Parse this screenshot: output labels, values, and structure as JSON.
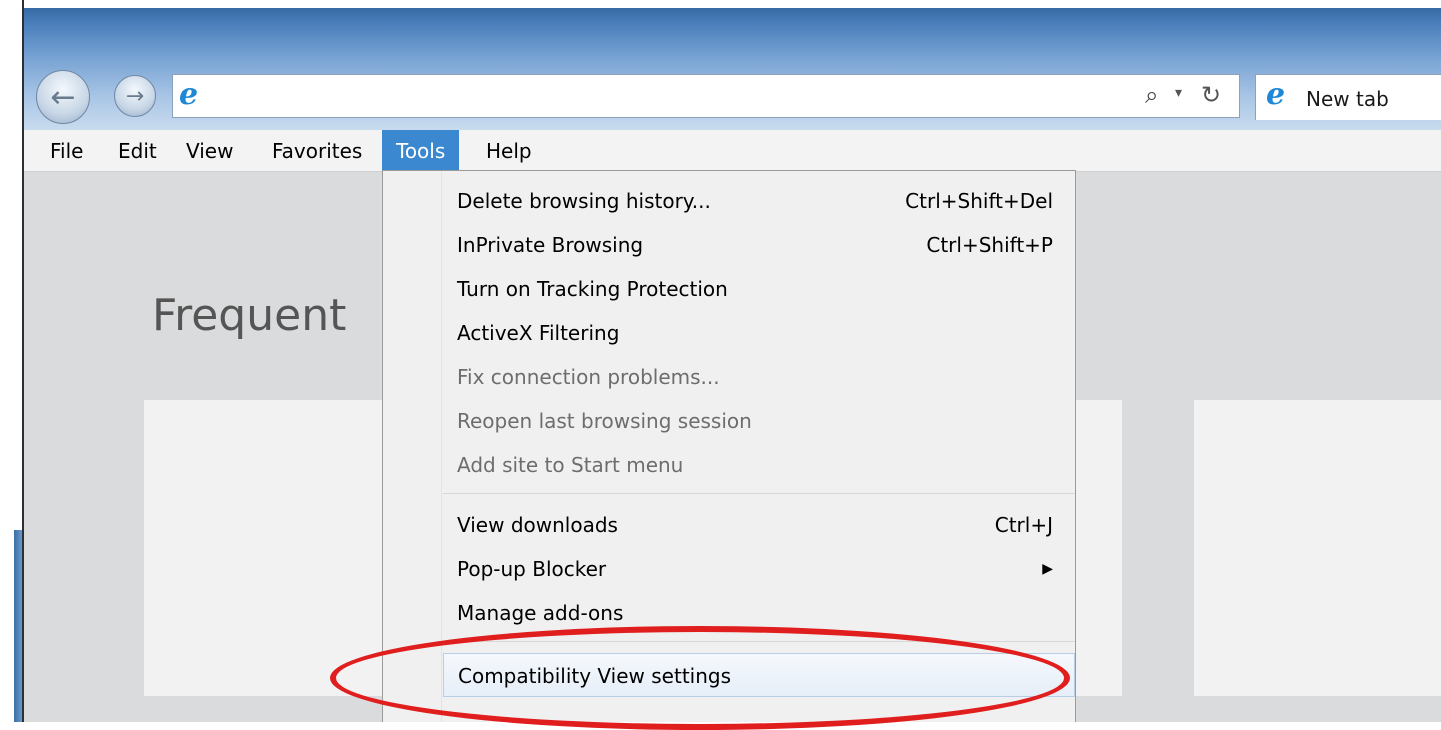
{
  "browser": {
    "back_icon": "back-arrow-icon",
    "forward_icon": "forward-arrow-icon",
    "ie_icon_glyph": "e",
    "tab_label": "New tab",
    "address_icons": {
      "search_glyph": "⌕",
      "dropdown_glyph": "▾",
      "refresh_glyph": "↻"
    }
  },
  "menubar": {
    "items": [
      {
        "label": "File"
      },
      {
        "label": "Edit"
      },
      {
        "label": "View"
      },
      {
        "label": "Favorites"
      },
      {
        "label": "Tools",
        "active": true
      },
      {
        "label": "Help"
      }
    ]
  },
  "content": {
    "heading": "Frequent"
  },
  "tools_menu": {
    "items": [
      {
        "label": "Delete browsing history...",
        "shortcut": "Ctrl+Shift+Del"
      },
      {
        "label": "InPrivate Browsing",
        "shortcut": "Ctrl+Shift+P"
      },
      {
        "label": "Turn on Tracking Protection",
        "shortcut": ""
      },
      {
        "label": "ActiveX Filtering",
        "shortcut": ""
      },
      {
        "label": "Fix connection problems...",
        "shortcut": "",
        "disabled": true
      },
      {
        "label": "Reopen last browsing session",
        "shortcut": "",
        "disabled": true
      },
      {
        "label": "Add site to Start menu",
        "shortcut": "",
        "disabled": true
      },
      {
        "label": "View downloads",
        "shortcut": "Ctrl+J"
      },
      {
        "label": "Pop-up Blocker",
        "shortcut": "",
        "submenu": true
      },
      {
        "label": "Manage add-ons",
        "shortcut": ""
      },
      {
        "label": "Compatibility View settings",
        "shortcut": "",
        "highlighted": true
      }
    ],
    "submenu_arrow": "▶"
  },
  "colors": {
    "menu_active": "#3b88d0",
    "annotation_circle": "#e01e1e",
    "ie_blue": "#1e88d6"
  }
}
